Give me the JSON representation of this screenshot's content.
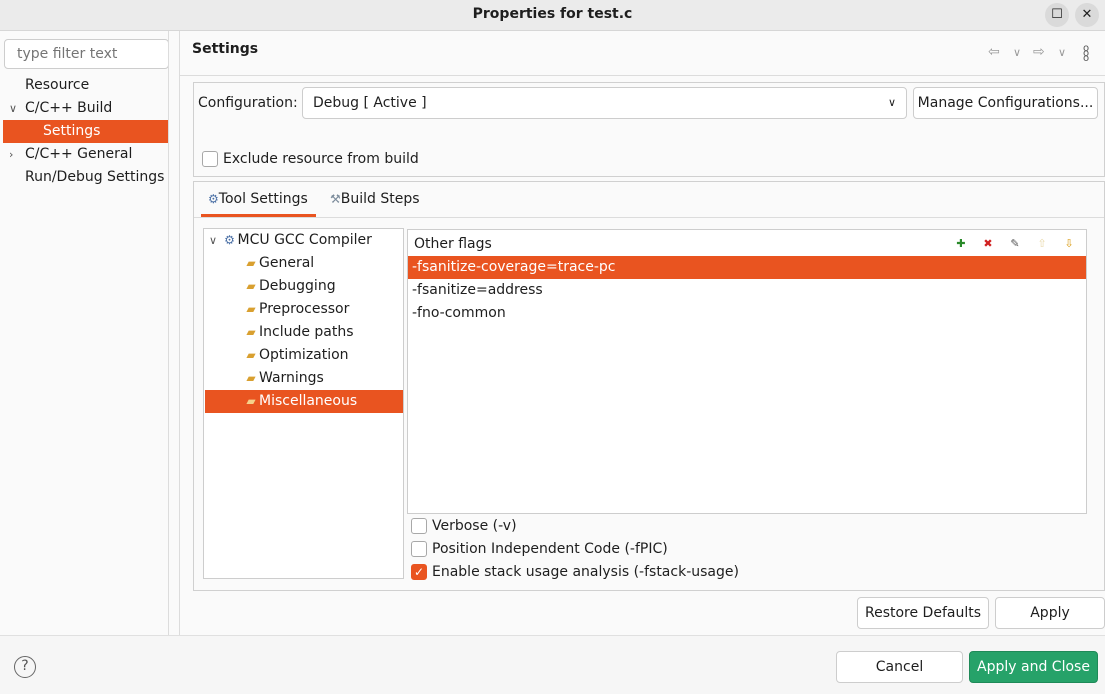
{
  "window": {
    "title": "Properties for test.c",
    "maximize_icon": "square-icon",
    "close_icon": "close-icon"
  },
  "sidebar": {
    "filter_placeholder": "type filter text",
    "items": [
      {
        "label": "Resource"
      },
      {
        "label": "C/C++ Build",
        "expanded": true
      },
      {
        "label": "Settings",
        "selected": true
      },
      {
        "label": "C/C++ General",
        "expanded": false
      },
      {
        "label": "Run/Debug Settings"
      }
    ]
  },
  "header": {
    "title": "Settings"
  },
  "configuration": {
    "label": "Configuration:",
    "value": "Debug  [ Active ]",
    "manage_label": "Manage Configurations...",
    "exclude_label": "Exclude resource from build",
    "exclude_checked": false
  },
  "tabs": [
    {
      "label": "Tool Settings",
      "active": true
    },
    {
      "label": "Build Steps"
    }
  ],
  "tool_tree": {
    "root": "MCU GCC Compiler",
    "items": [
      "General",
      "Debugging",
      "Preprocessor",
      "Include paths",
      "Optimization",
      "Warnings",
      "Miscellaneous"
    ],
    "selected": "Miscellaneous"
  },
  "flags": {
    "header": "Other flags",
    "items": [
      "-fsanitize-coverage=trace-pc",
      "-fsanitize=address",
      "-fno-common"
    ],
    "selected_index": 0,
    "toolbar_icons": [
      "add-icon",
      "delete-icon",
      "edit-icon",
      "move-up-icon",
      "move-down-icon"
    ]
  },
  "options": [
    {
      "label": "Verbose (-v)",
      "checked": false
    },
    {
      "label": "Position Independent Code (-fPIC)",
      "checked": false
    },
    {
      "label": "Enable stack usage analysis (-fstack-usage)",
      "checked": true
    }
  ],
  "buttons": {
    "restore": "Restore Defaults",
    "apply": "Apply",
    "cancel": "Cancel",
    "apply_close": "Apply and Close"
  },
  "colors": {
    "accent": "#e95420",
    "primary_button": "#26a269"
  }
}
